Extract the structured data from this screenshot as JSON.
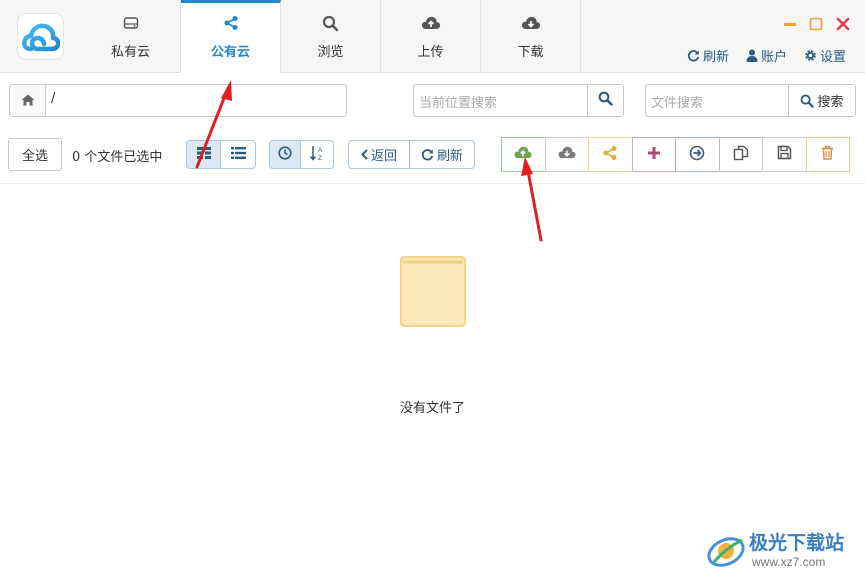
{
  "tabs": [
    {
      "label": "私有云",
      "icon": "hard-drive-icon"
    },
    {
      "label": "公有云",
      "icon": "share-icon"
    },
    {
      "label": "浏览",
      "icon": "search-icon"
    },
    {
      "label": "上传",
      "icon": "cloud-upload-icon"
    },
    {
      "label": "下载",
      "icon": "cloud-download-icon"
    }
  ],
  "header": {
    "refresh_label": "刷新",
    "account_label": "账户",
    "settings_label": "设置"
  },
  "path": {
    "value": "/",
    "location_search_placeholder": "当前位置搜索",
    "file_search_placeholder": "文件搜索",
    "search_button_label": "搜索"
  },
  "toolbar": {
    "select_all_label": "全选",
    "selected_count_text": "0 个文件已选中",
    "back_label": "返回",
    "refresh_label": "刷新"
  },
  "actions": [
    {
      "name": "upload",
      "icon": "cloud-upload-icon",
      "color": "#6aa84f"
    },
    {
      "name": "download",
      "icon": "cloud-download-icon",
      "color": "#7c7c7c"
    },
    {
      "name": "share",
      "icon": "share-icon",
      "color": "#e0b03a"
    },
    {
      "name": "new",
      "icon": "plus-icon",
      "color": "#b04a7a"
    },
    {
      "name": "move",
      "icon": "arrow-circle-right-icon",
      "color": "#3d5b7a"
    },
    {
      "name": "copy",
      "icon": "copy-icon",
      "color": "#8a6a9a"
    },
    {
      "name": "save",
      "icon": "save-icon",
      "color": "#555555"
    },
    {
      "name": "delete",
      "icon": "trash-icon",
      "color": "#e08a3a"
    }
  ],
  "empty": {
    "message": "没有文件了"
  },
  "watermark": {
    "title": "极光下载站",
    "url": "www.xz7.com"
  },
  "colors": {
    "accent": "#1e88c8",
    "annotation_arrow": "#e02020"
  }
}
